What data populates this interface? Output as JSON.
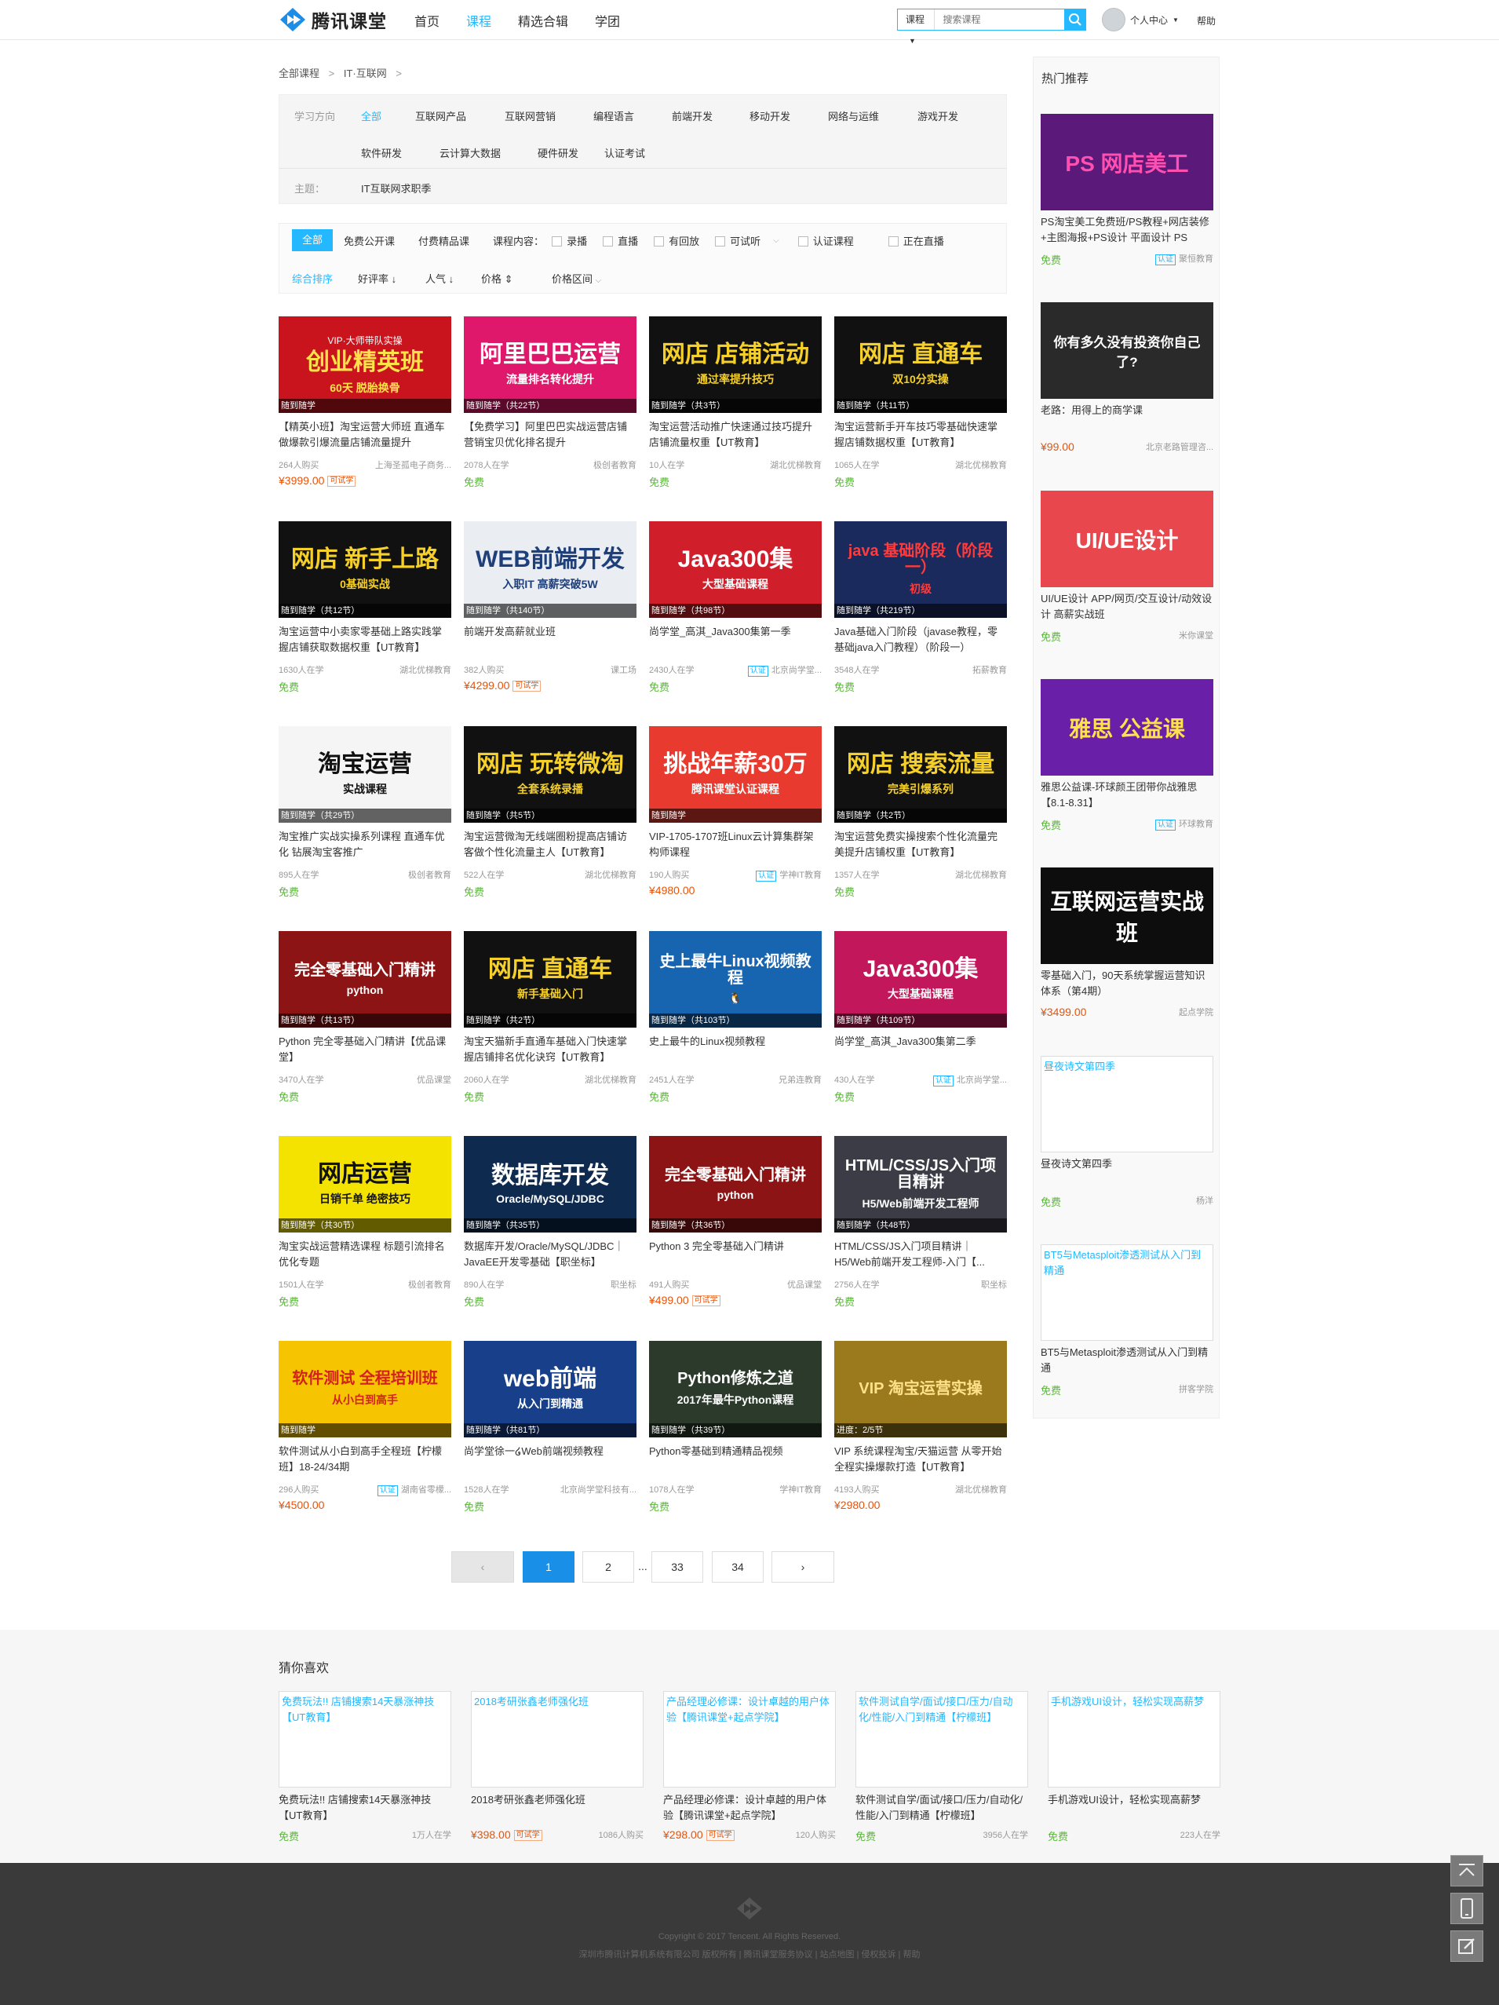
{
  "header": {
    "logo": "腾讯课堂",
    "nav": [
      "首页",
      "课程",
      "精选合辑",
      "学团"
    ],
    "search_scope": "课程",
    "search_placeholder": "搜索课程",
    "user_label": "个人中心",
    "help": "帮助"
  },
  "breadcrumb": {
    "root": "全部课程",
    "sep": ">",
    "current": "IT·互联网"
  },
  "filters": {
    "direction_label": "学习方向",
    "directions_row1": [
      "全部",
      "互联网产品",
      "互联网营销",
      "编程语言",
      "前端开发",
      "移动开发",
      "网络与运维",
      "游戏开发"
    ],
    "directions_row2": [
      "软件研发",
      "云计算大数据",
      "硬件研发",
      "认证考试"
    ],
    "theme_label": "主题：",
    "theme": "IT互联网求职季"
  },
  "sortbar": {
    "types": [
      "全部",
      "免费公开课",
      "付费精品课"
    ],
    "content_label": "课程内容：",
    "content_opts": [
      "录播",
      "直播",
      "有回放",
      "可试听"
    ],
    "extra_opts": [
      "认证课程",
      "正在直播"
    ],
    "sorts": [
      "综合排序",
      "好评率",
      "人气",
      "价格"
    ],
    "price_range": "价格区间"
  },
  "courses": [
    {
      "thumb": "创业精英班",
      "sub": "60天 脱胎换骨",
      "top": "VIP·大师带队实操",
      "strip": "随到随学",
      "title": "【精英小班】淘宝运营大师班 直通车做爆款引爆流量店铺流量提升",
      "people": "264人购买",
      "org": "上海圣孤电子商务...",
      "price": "¥3999.00",
      "free": false,
      "trial": "可试学",
      "bg": "#c9141e",
      "fg": "#ffe14a"
    },
    {
      "thumb": "阿里巴巴运营",
      "sub": "流量排名转化提升",
      "strip": "随到随学（共22节）",
      "title": "【免费学习】阿里巴巴实战运营店铺营销宝贝优化排名提升",
      "people": "2078人在学",
      "org": "极创者教育",
      "price": "免费",
      "free": true,
      "bg": "#e0186b",
      "fg": "#ffffff"
    },
    {
      "thumb": "网店 店铺活动",
      "sub": "通过率提升技巧",
      "strip": "随到随学（共3节）",
      "title": "淘宝运营活动推广快速通过技巧提升店铺流量权重【UT教育】",
      "people": "10人在学",
      "org": "湖北优梯教育",
      "price": "免费",
      "free": true,
      "bg": "#111111",
      "fg": "#f6d02a"
    },
    {
      "thumb": "网店 直通车",
      "sub": "双10分实操",
      "strip": "随到随学（共11节）",
      "title": "淘宝运营新手开车技巧零基础快速掌握店铺数据权重【UT教育】",
      "people": "1065人在学",
      "org": "湖北优梯教育",
      "price": "免费",
      "free": true,
      "bg": "#111111",
      "fg": "#f6d02a"
    },
    {
      "thumb": "网店 新手上路",
      "sub": "0基础实战",
      "strip": "随到随学（共12节）",
      "title": "淘宝运营中小卖家零基础上路实践掌握店铺获取数据权重【UT教育】",
      "people": "1630人在学",
      "org": "湖北优梯教育",
      "price": "免费",
      "free": true,
      "bg": "#111111",
      "fg": "#f6d02a"
    },
    {
      "thumb": "WEB前端开发",
      "sub": "入职IT 高薪突破5W",
      "strip": "随到随学（共140节）",
      "title": "前端开发高薪就业班",
      "people": "382人购买",
      "org": "课工场",
      "price": "¥4299.00",
      "free": false,
      "trial": "可试学",
      "bg": "#eaeef3",
      "fg": "#1e3f7a"
    },
    {
      "thumb": "Java300集",
      "sub": "大型基础课程",
      "strip": "随到随学（共98节）",
      "title": "尚学堂_高淇_Java300集第一季",
      "people": "2430人在学",
      "org": "北京尚学堂...",
      "cert": "认证",
      "price": "免费",
      "free": true,
      "bg": "#d01e2a",
      "fg": "#ffffff"
    },
    {
      "thumb": "java 基础阶段（阶段一）",
      "sub": "初级",
      "strip": "随到随学（共219节）",
      "title": "Java基础入门阶段（javase教程，零基础java入门教程）（阶段一）",
      "people": "3548人在学",
      "org": "拓薪教育",
      "price": "免费",
      "free": true,
      "bg": "#1a2a5c",
      "fg": "#ff3b3b"
    },
    {
      "thumb": "淘宝运营",
      "sub": "实战课程",
      "strip": "随到随学（共29节）",
      "title": "淘宝推广实战实操系列课程 直通车优化 钻展淘宝客推广",
      "people": "895人在学",
      "org": "极创者教育",
      "price": "免费",
      "free": true,
      "bg": "#f5f5f5",
      "fg": "#111111"
    },
    {
      "thumb": "网店 玩转微淘",
      "sub": "全套系统录播",
      "strip": "随到随学（共5节）",
      "title": "淘宝运营微淘无线端圈粉提高店铺访客做个性化流量主人【UT教育】",
      "people": "522人在学",
      "org": "湖北优梯教育",
      "price": "免费",
      "free": true,
      "bg": "#111111",
      "fg": "#f6d02a"
    },
    {
      "thumb": "挑战年薪30万",
      "sub": "腾讯课堂认证课程",
      "strip": "随到随学",
      "title": "VIP-1705-1707班Linux云计算集群架构师课程",
      "people": "190人购买",
      "org": "学神IT教育",
      "cert": "认证",
      "price": "¥4980.00",
      "free": false,
      "bg": "#e83a2e",
      "fg": "#ffffff"
    },
    {
      "thumb": "网店 搜索流量",
      "sub": "完美引爆系列",
      "strip": "随到随学（共2节）",
      "title": "淘宝运营免费实操搜索个性化流量完美提升店铺权重【UT教育】",
      "people": "1357人在学",
      "org": "湖北优梯教育",
      "price": "免费",
      "free": true,
      "bg": "#111111",
      "fg": "#f6d02a"
    },
    {
      "thumb": "完全零基础入门精讲",
      "sub": "python",
      "strip": "随到随学（共13节）",
      "title": "Python 完全零基础入门精讲【优品课堂】",
      "people": "3470人在学",
      "org": "优品课堂",
      "price": "免费",
      "free": true,
      "bg": "#8c1414",
      "fg": "#ffffff"
    },
    {
      "thumb": "网店 直通车",
      "sub": "新手基础入门",
      "strip": "随到随学（共2节）",
      "title": "淘宝天猫新手直通车基础入门快速掌握店铺排名优化诀窍【UT教育】",
      "people": "2060人在学",
      "org": "湖北优梯教育",
      "price": "免费",
      "free": true,
      "bg": "#111111",
      "fg": "#f6d02a"
    },
    {
      "thumb": "史上最牛Linux视频教程",
      "sub": "🐧",
      "strip": "随到随学（共103节）",
      "title": "史上最牛的Linux视频教程",
      "people": "2451人在学",
      "org": "兄弟连教育",
      "price": "免费",
      "free": true,
      "bg": "#1765b0",
      "fg": "#ffffff"
    },
    {
      "thumb": "Java300集",
      "sub": "大型基础课程",
      "strip": "随到随学（共109节）",
      "title": "尚学堂_高淇_Java300集第二季",
      "people": "430人在学",
      "org": "北京尚学堂...",
      "cert": "认证",
      "price": "免费",
      "free": true,
      "bg": "#c2185b",
      "fg": "#ffffff"
    },
    {
      "thumb": "网店运营",
      "sub": "日销千单 绝密技巧",
      "strip": "随到随学（共30节）",
      "title": "淘宝实战运营精选课程 标题引流排名优化专题",
      "people": "1501人在学",
      "org": "极创者教育",
      "price": "免费",
      "free": true,
      "bg": "#f4e300",
      "fg": "#111111"
    },
    {
      "thumb": "数据库开发",
      "sub": "Oracle/MySQL/JDBC",
      "strip": "随到随学（共35节）",
      "title": "数据库开发/Oracle/MySQL/JDBC｜JavaEE开发零基础【职坐标】",
      "people": "890人在学",
      "org": "职坐标",
      "price": "免费",
      "free": true,
      "bg": "#0e2a4f",
      "fg": "#ffffff"
    },
    {
      "thumb": "完全零基础入门精讲",
      "sub": "python",
      "strip": "随到随学（共36节）",
      "title": "Python 3 完全零基础入门精讲",
      "people": "491人购买",
      "org": "优品课堂",
      "price": "¥499.00",
      "free": false,
      "trial": "可试学",
      "bg": "#8c1414",
      "fg": "#ffffff"
    },
    {
      "thumb": "HTML/CSS/JS入门项目精讲",
      "sub": "H5/Web前端开发工程师",
      "strip": "随到随学（共48节）",
      "title": "HTML/CSS/JS入门项目精讲｜H5/Web前端开发工程师-入门【...",
      "people": "2756人在学",
      "org": "职坐标",
      "price": "免费",
      "free": true,
      "bg": "#3c3c46",
      "fg": "#ffffff"
    },
    {
      "thumb": "软件测试 全程培训班",
      "sub": "从小白到高手",
      "strip": "随到随学",
      "title": "软件测试从小白到高手全程班【柠檬班】18-24/34期",
      "people": "296人购买",
      "org": "湖南省零檬...",
      "cert": "认证",
      "price": "¥4500.00",
      "free": false,
      "bg": "#f6c400",
      "fg": "#d42020"
    },
    {
      "thumb": "web前端",
      "sub": "从入门到精通",
      "strip": "随到随学（共81节）",
      "title": "尚学堂徐一໒Web前端视频教程",
      "people": "1528人在学",
      "org": "北京尚学堂科技有...",
      "price": "免费",
      "free": true,
      "bg": "#173f8a",
      "fg": "#ffffff"
    },
    {
      "thumb": "Python修炼之道",
      "sub": "2017年最牛Python课程",
      "strip": "随到随学（共39节）",
      "title": "Python零基础到精通精品视频",
      "people": "1078人在学",
      "org": "学神IT教育",
      "price": "免费",
      "free": true,
      "bg": "#2b3a2b",
      "fg": "#ffffff"
    },
    {
      "thumb": "VIP 淘宝运营实操",
      "sub": "",
      "strip": "进度：2/5节",
      "title": "VIP 系统课程淘宝/天猫运营 从零开始全程实操爆款打造【UT教育】",
      "people": "4193人购买",
      "org": "湖北优梯教育",
      "price": "¥2980.00",
      "free": false,
      "bg": "#9a7a1c",
      "fg": "#ffe18a"
    }
  ],
  "sidebar": {
    "title": "热门推荐",
    "items": [
      {
        "thumb": "PS 网店美工",
        "title": "PS淘宝美工免费班/PS教程+网店装修+主图海报+PS设计 平面设计 PS",
        "price": "免费",
        "org": "聚恒教育",
        "cert": "认证",
        "bg": "#5b1a7a",
        "fg": "#ff4fb0"
      },
      {
        "thumb": "你有多久没有投资你自己了?",
        "title": "老路：用得上的商学课",
        "price": "¥99.00",
        "org": "北京老路管理咨...",
        "bg": "#2a2a2a",
        "fg": "#ffffff"
      },
      {
        "thumb": "UI/UE设计",
        "title": "UI/UE设计 APP/网页/交互设计/动效设计 高薪实战班",
        "price": "免费",
        "org": "米你课堂",
        "bg": "#e8474e",
        "fg": "#ffffff"
      },
      {
        "thumb": "雅思 公益课",
        "title": "雅思公益课-环球颜王团带你战雅思【8.1-8.31】",
        "price": "免费",
        "org": "环球教育",
        "cert": "认证",
        "bg": "#6a1fa8",
        "fg": "#ffe14a"
      },
      {
        "thumb": "互联网运营实战班",
        "title": "零基础入门，90天系统掌握运营知识体系（第4期）",
        "price": "¥3499.00",
        "org": "起点学院",
        "bg": "#0d0d0d",
        "fg": "#ffffff"
      },
      {
        "thumb": "",
        "placeholder": "昼夜诗文第四季",
        "title": "昼夜诗文第四季",
        "price": "免费",
        "org": "杨洋"
      },
      {
        "thumb": "",
        "placeholder": "BT5与Metasploit渗透测试从入门到精通",
        "title": "BT5与Metasploit渗透测试从入门到精通",
        "price": "免费",
        "org": "拼客学院"
      }
    ]
  },
  "pager": {
    "prev": "‹",
    "pages": [
      "1",
      "2",
      "...",
      "33",
      "34"
    ],
    "next": "›"
  },
  "guess": {
    "title": "猜你喜欢",
    "items": [
      {
        "placeholder": "免费玩法!! 店铺搜索14天暴涨神技【UT教育】",
        "title": "免费玩法!! 店铺搜索14天暴涨神技【UT教育】",
        "price": "免费",
        "count": "1万人在学"
      },
      {
        "placeholder": "2018考研张鑫老师强化班",
        "title": "2018考研张鑫老师强化班",
        "price": "¥398.00",
        "trial": "可试学",
        "count": "1086人购买"
      },
      {
        "placeholder": "产品经理必修课：设计卓越的用户体验【腾讯课堂+起点学院】",
        "title": "产品经理必修课：设计卓越的用户体验【腾讯课堂+起点学院】",
        "price": "¥298.00",
        "trial": "可试学",
        "count": "120人购买"
      },
      {
        "placeholder": "软件测试自学/面试/接口/压力/自动化/性能/入门到精通【柠檬班】",
        "title": "软件测试自学/面试/接口/压力/自动化/性能/入门到精通【柠檬班】",
        "price": "免费",
        "count": "3956人在学"
      },
      {
        "placeholder": "手机游戏UI设计，轻松实现高薪梦",
        "title": "手机游戏UI设计，轻松实现高薪梦",
        "price": "免费",
        "count": "223人在学"
      }
    ]
  },
  "footer": {
    "copyright": "Copyright © 2017 Tencent. All Rights Reserved.",
    "links": "深圳市腾讯计算机系统有限公司 版权所有 | 腾讯课堂服务协议 | 站点地图 | 侵权投诉 | 帮助"
  },
  "colors": {
    "accent": "#23b8ff",
    "price": "#e85308",
    "free": "#5ab839"
  }
}
